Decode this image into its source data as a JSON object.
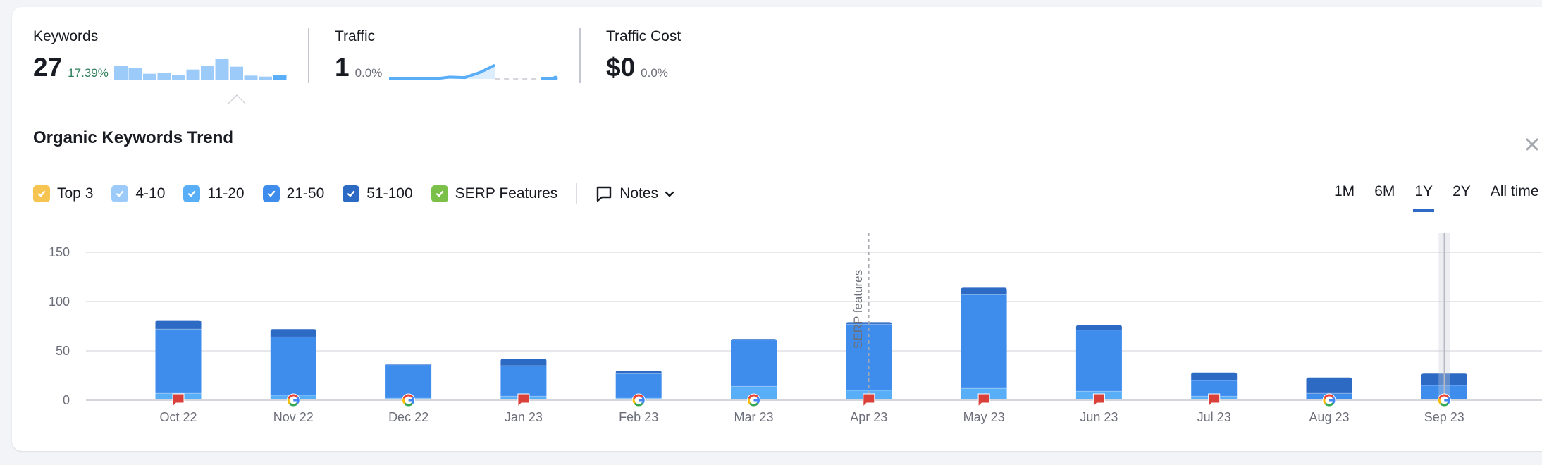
{
  "summary": {
    "keywords": {
      "label": "Keywords",
      "value": "27",
      "change": "17.39%",
      "sparkline": [
        30,
        27,
        14,
        16,
        11,
        23,
        31,
        45,
        29,
        10,
        8,
        11
      ]
    },
    "traffic": {
      "label": "Traffic",
      "value": "1",
      "change": "0.0%",
      "sparkline": [
        0,
        0,
        0,
        0,
        0.1,
        0.07,
        0.35,
        0.75,
        null,
        null,
        null,
        0.05
      ]
    },
    "traffic_cost": {
      "label": "Traffic Cost",
      "value": "$0",
      "change": "0.0%"
    }
  },
  "panel": {
    "title": "Organic Keywords Trend",
    "close_icon": "close-icon",
    "legend": [
      {
        "label": "Top 3",
        "color": "#f5c451",
        "checked": true
      },
      {
        "label": "4-10",
        "color": "#9ccbfa",
        "checked": true
      },
      {
        "label": "11-20",
        "color": "#59aef8",
        "checked": true
      },
      {
        "label": "21-50",
        "color": "#3e8ded",
        "checked": true
      },
      {
        "label": "51-100",
        "color": "#2d6ac3",
        "checked": true
      },
      {
        "label": "SERP Features",
        "color": "#7bc149",
        "checked": true
      }
    ],
    "notes_label": "Notes",
    "periods": [
      {
        "label": "1M",
        "active": false
      },
      {
        "label": "6M",
        "active": false
      },
      {
        "label": "1Y",
        "active": true
      },
      {
        "label": "2Y",
        "active": false
      },
      {
        "label": "All time",
        "active": false
      }
    ]
  },
  "chart_data": {
    "type": "bar",
    "stacked": true,
    "title": "Organic Keywords Trend",
    "xlabel": "",
    "ylabel": "",
    "ylim": [
      0,
      150
    ],
    "yticks": [
      0,
      50,
      100,
      150
    ],
    "grid": true,
    "categories": [
      "Oct 22",
      "Nov 22",
      "Dec 22",
      "Jan 23",
      "Feb 23",
      "Mar 23",
      "Apr 23",
      "May 23",
      "Jun 23",
      "Jul 23",
      "Aug 23",
      "Sep 23"
    ],
    "series": [
      {
        "name": "Top 3",
        "color": "#f5c451",
        "values": [
          0,
          0,
          0,
          0,
          0,
          0,
          0,
          0,
          0,
          0,
          0,
          0
        ]
      },
      {
        "name": "4-10",
        "color": "#9ccbfa",
        "values": [
          0,
          0,
          0,
          0,
          0,
          0,
          0,
          0,
          0,
          0,
          0,
          0
        ]
      },
      {
        "name": "11-20",
        "color": "#59aef8",
        "values": [
          7,
          5,
          2,
          4,
          2,
          14,
          10,
          12,
          9,
          4,
          1,
          0
        ]
      },
      {
        "name": "21-50",
        "color": "#3e8ded",
        "values": [
          65,
          59,
          34,
          31,
          25,
          47,
          67,
          95,
          62,
          16,
          6,
          15
        ]
      },
      {
        "name": "51-100",
        "color": "#2d6ac3",
        "values": [
          9,
          8,
          1,
          7,
          3,
          1,
          2,
          7,
          5,
          8,
          16,
          12
        ]
      }
    ],
    "markers": [
      "note",
      "google",
      "google",
      "note",
      "google",
      "google",
      "note",
      "note",
      "note",
      "note",
      "google",
      "google"
    ],
    "annotations": [
      {
        "category": "Apr 23",
        "label": "SERP features",
        "style": "dashed-vertical"
      }
    ],
    "highlighted_category": "Sep 23"
  }
}
